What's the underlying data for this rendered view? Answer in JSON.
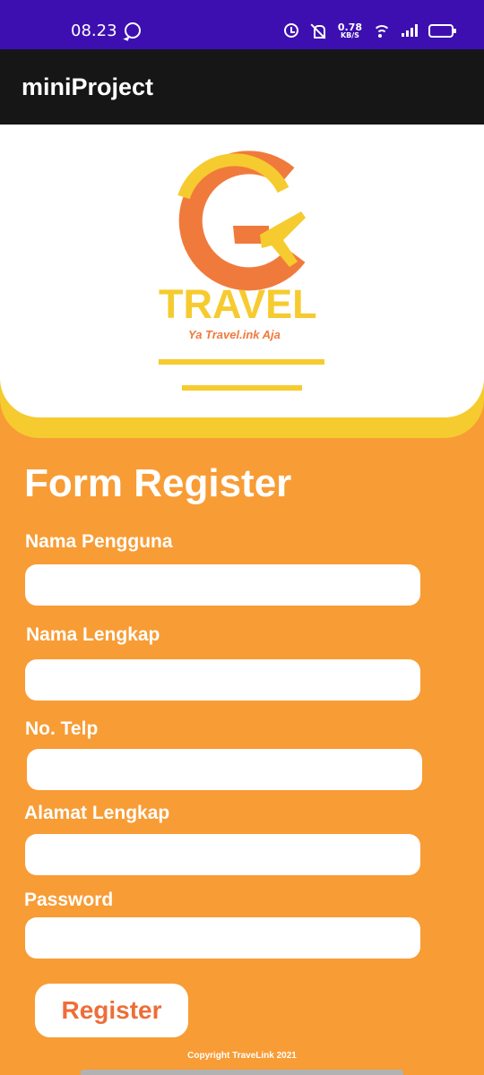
{
  "status_bar": {
    "time": "08.23",
    "net_speed_value": "0.78",
    "net_speed_unit": "KB/S",
    "icons": [
      "whatsapp-icon",
      "alarm-icon",
      "mute-icon",
      "wifi-icon",
      "signal-icon",
      "battery-icon"
    ],
    "color": "#3D0FB0"
  },
  "app_bar": {
    "title": "miniProject",
    "color": "#161616"
  },
  "logo": {
    "brand": "TRAVEL",
    "tagline": "Ya Travel.ink Aja",
    "colors": {
      "yellow": "#F6CB2F",
      "orange": "#F07A3C"
    }
  },
  "form": {
    "title": "Form Register",
    "fields": [
      {
        "label": "Nama Pengguna",
        "value": ""
      },
      {
        "label": "Nama Lengkap",
        "value": ""
      },
      {
        "label": "No. Telp",
        "value": ""
      },
      {
        "label": "Alamat Lengkap",
        "value": ""
      },
      {
        "label": "Password",
        "value": ""
      }
    ],
    "register_label": "Register",
    "background_color": "#F89C35",
    "button_text_color": "#EE6D38"
  },
  "footer": {
    "copyright": "Copyright TraveLink 2021"
  }
}
